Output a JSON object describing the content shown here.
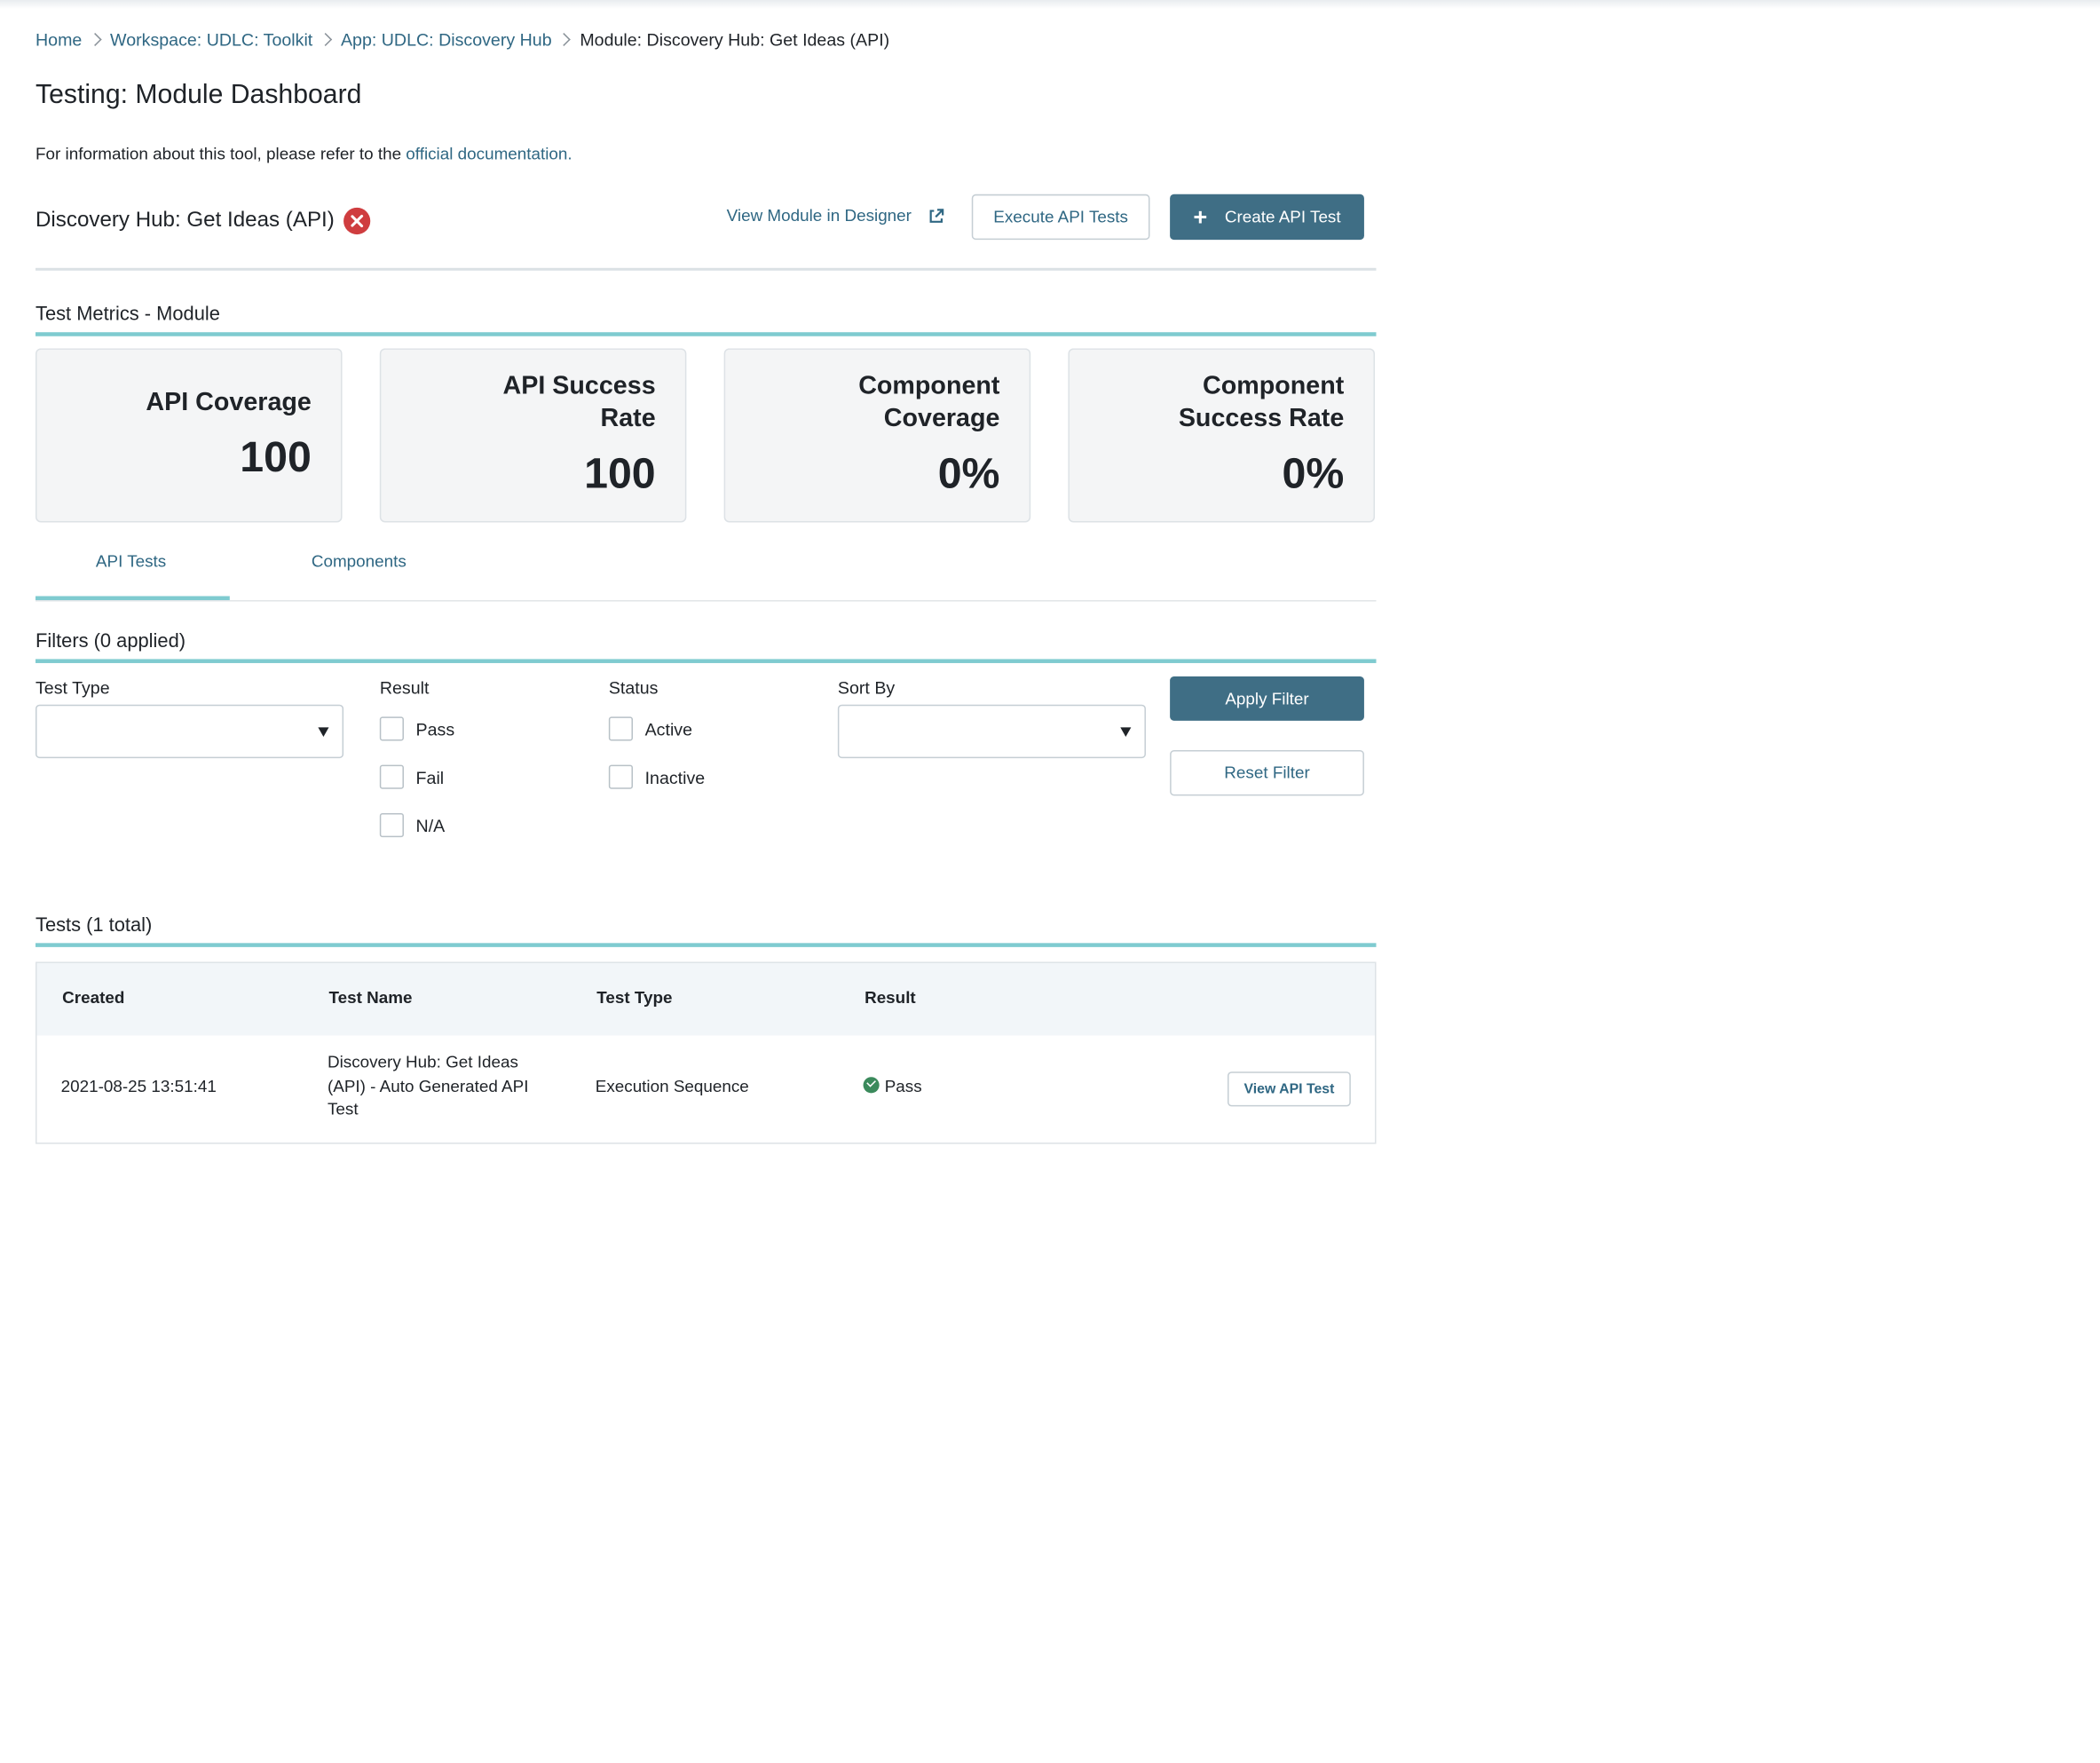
{
  "breadcrumb": {
    "items": [
      "Home",
      "Workspace: UDLC: Toolkit",
      "App: UDLC: Discovery Hub"
    ],
    "current": "Module: Discovery Hub: Get Ideas (API)"
  },
  "page_title": "Testing: Module Dashboard",
  "info": {
    "text": "For information about this tool, please refer to the ",
    "link": "official documentation."
  },
  "module": {
    "title": "Discovery Hub: Get Ideas (API)",
    "status_icon": "error-circle-icon",
    "view_designer_label": "View Module in Designer",
    "execute_label": "Execute API Tests",
    "create_label": "Create API Test"
  },
  "metrics": {
    "title": "Test Metrics - Module",
    "cards": [
      {
        "label_lines": [
          "API Coverage"
        ],
        "value": "100"
      },
      {
        "label_lines": [
          "API Success",
          "Rate"
        ],
        "value": "100"
      },
      {
        "label_lines": [
          "Component",
          "Coverage"
        ],
        "value": "0%"
      },
      {
        "label_lines": [
          "Component",
          "Success Rate"
        ],
        "value": "0%"
      }
    ]
  },
  "tabs": [
    {
      "label": "API Tests",
      "active": true
    },
    {
      "label": "Components",
      "active": false
    }
  ],
  "filters": {
    "title": "Filters (0 applied)",
    "test_type_label": "Test Type",
    "test_type_value": "",
    "result_label": "Result",
    "result_options": [
      "Pass",
      "Fail",
      "N/A"
    ],
    "status_label": "Status",
    "status_options": [
      "Active",
      "Inactive"
    ],
    "sort_label": "Sort By",
    "sort_value": "",
    "apply_label": "Apply Filter",
    "reset_label": "Reset Filter"
  },
  "tests": {
    "title": "Tests (1 total)",
    "columns": [
      "Created",
      "Test Name",
      "Test Type",
      "Result"
    ],
    "rows": [
      {
        "created": "2021-08-25 13:51:41",
        "name_lines": [
          "Discovery Hub: Get Ideas",
          "(API) - Auto Generated API",
          "Test"
        ],
        "type": "Execution Sequence",
        "result": "Pass",
        "action": "View API Test"
      }
    ]
  },
  "colors": {
    "accent": "#3f6e85",
    "link": "#2f6783",
    "teal_rule": "#7fcbd0",
    "error": "#cf3d3f",
    "success": "#3b8a5c"
  }
}
